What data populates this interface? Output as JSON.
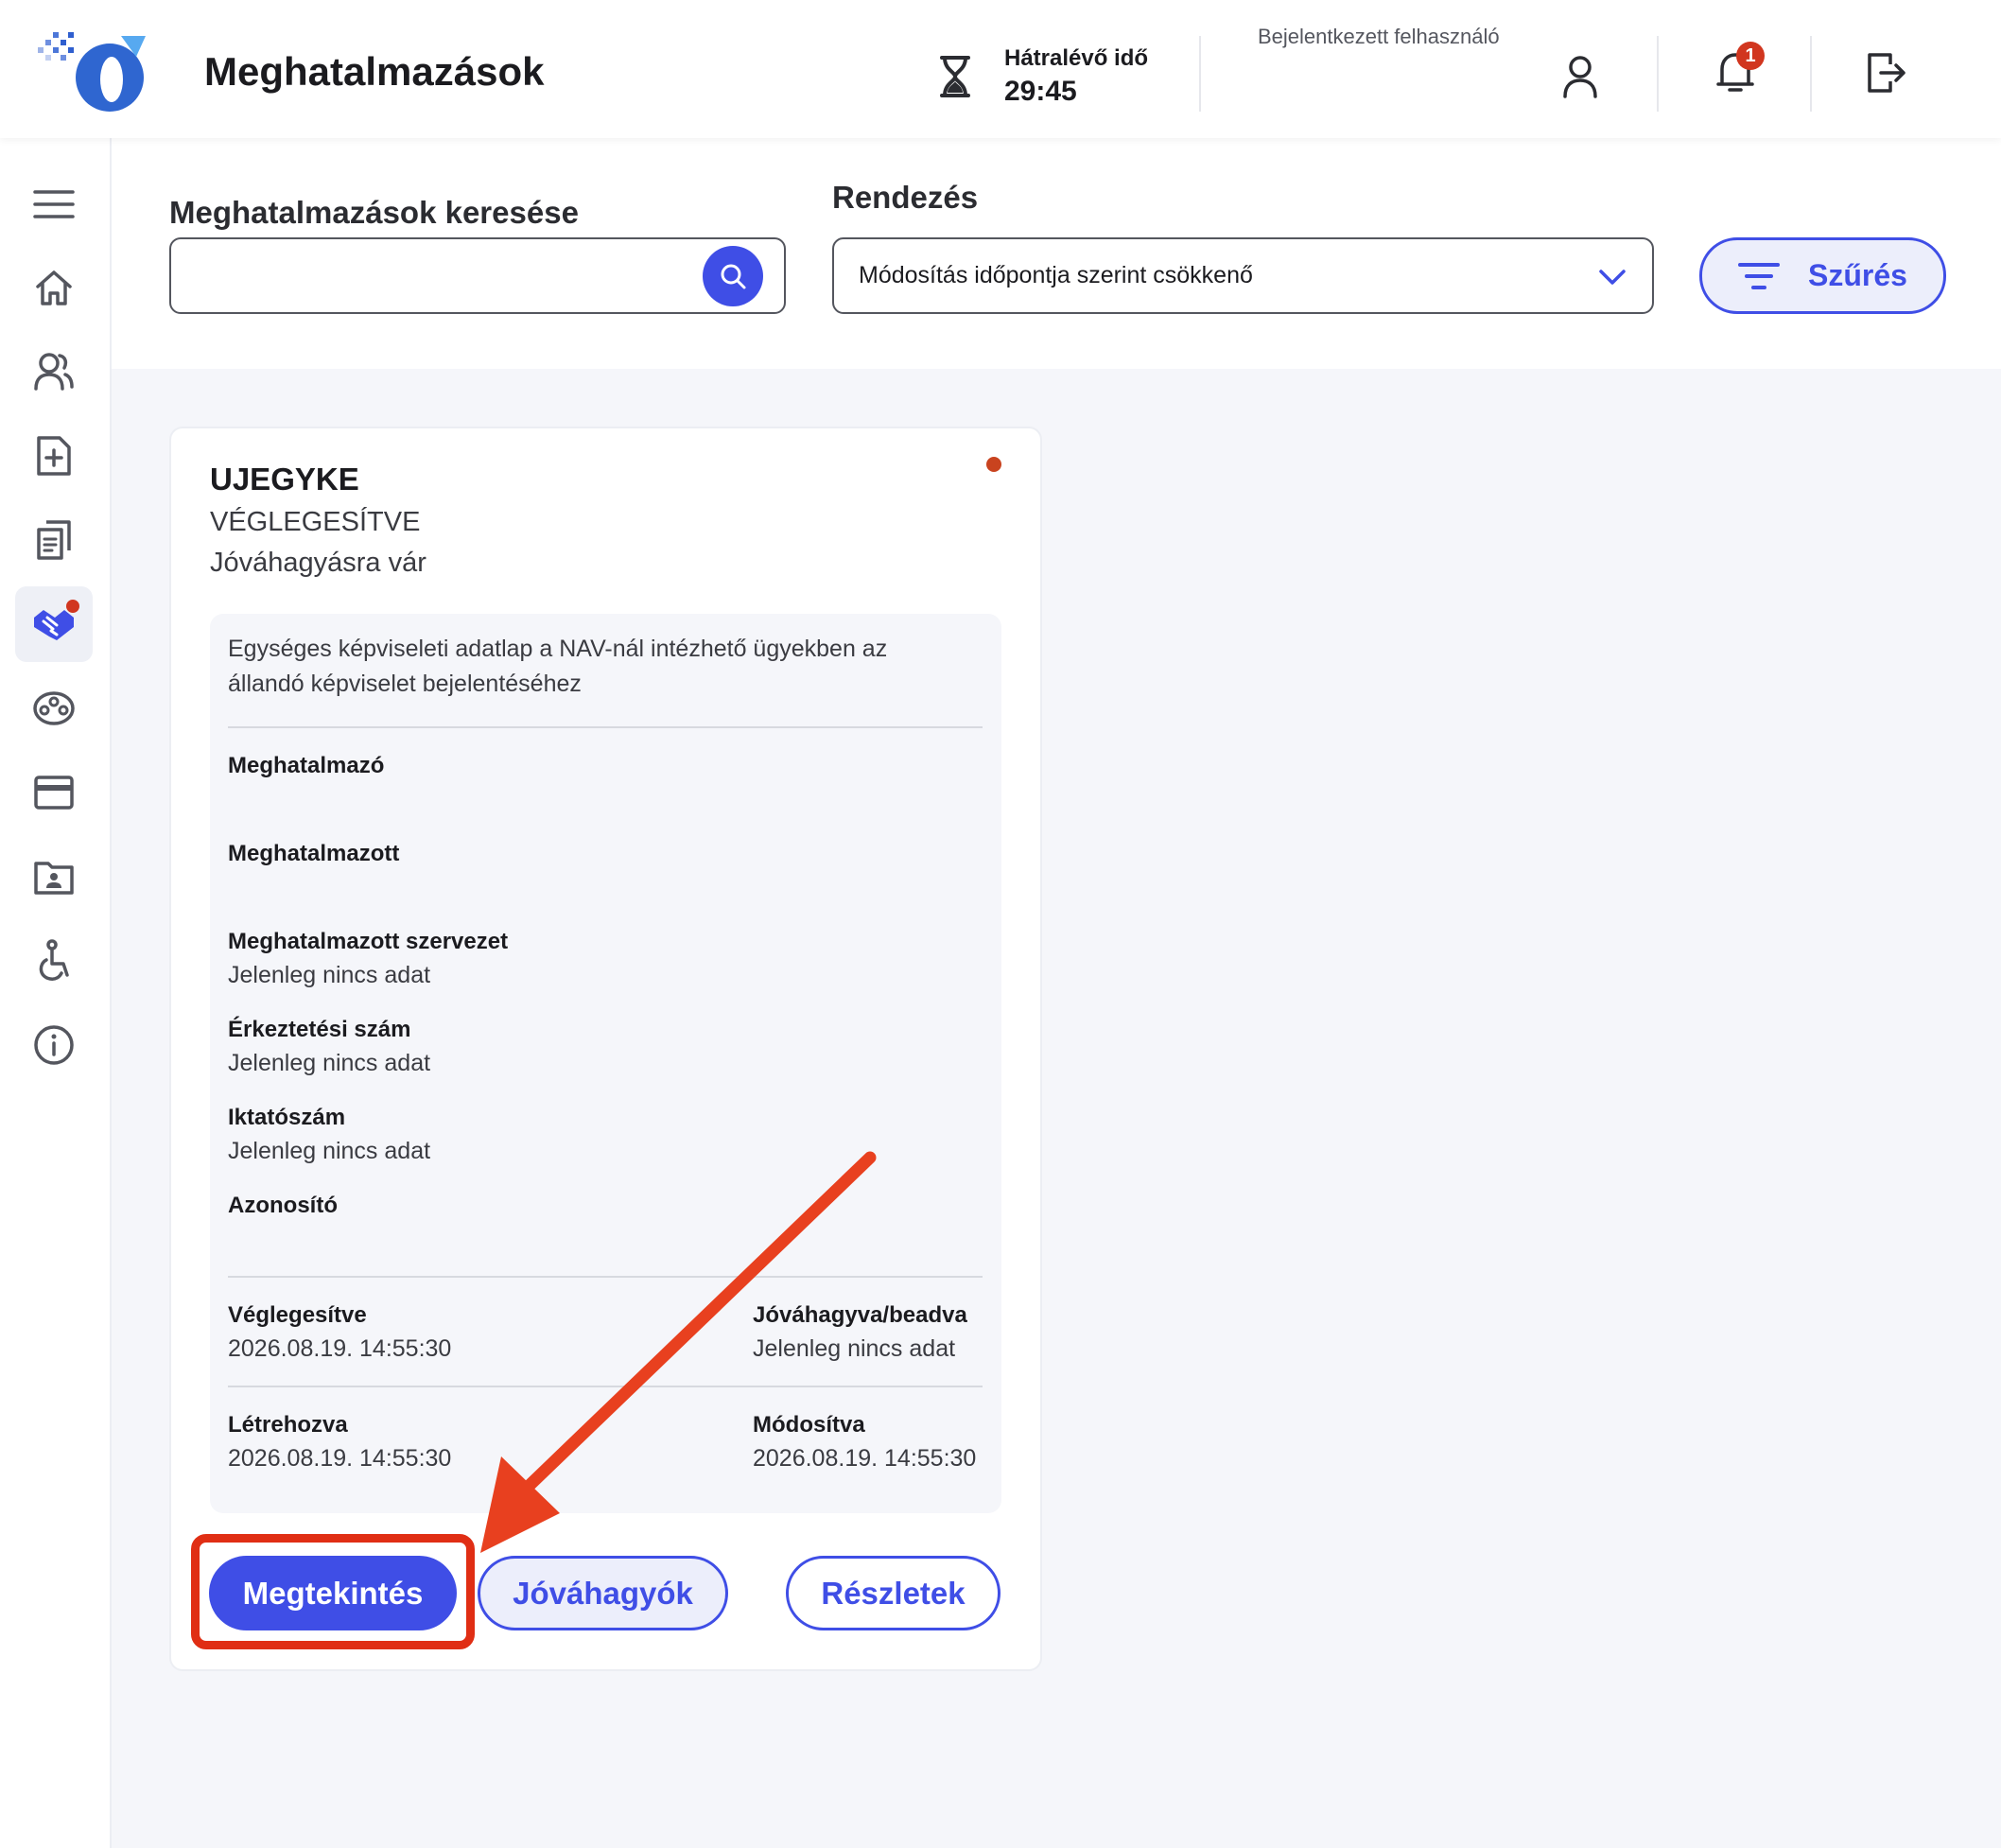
{
  "header": {
    "title": "Meghatalmazások",
    "timer_label": "Hátralévő idő",
    "timer_value": "29:45",
    "user_label": "Bejelentkezett felhasználó",
    "notification_count": "1"
  },
  "sidebar": {
    "items": [
      {
        "name": "menu",
        "icon": "hamburger-icon"
      },
      {
        "name": "home",
        "icon": "home-icon"
      },
      {
        "name": "users",
        "icon": "users-icon"
      },
      {
        "name": "new-document",
        "icon": "document-plus-icon"
      },
      {
        "name": "documents",
        "icon": "documents-icon"
      },
      {
        "name": "authorizations",
        "icon": "handshake-icon",
        "active": true
      },
      {
        "name": "community",
        "icon": "community-icon"
      },
      {
        "name": "payments",
        "icon": "card-icon"
      },
      {
        "name": "profile",
        "icon": "id-card-icon"
      },
      {
        "name": "accessibility",
        "icon": "accessibility-icon"
      },
      {
        "name": "info",
        "icon": "info-icon"
      }
    ]
  },
  "search": {
    "label": "Meghatalmazások keresése",
    "value": "",
    "placeholder": ""
  },
  "sort": {
    "label": "Rendezés",
    "selected": "Módosítás időpontja szerint csökkenő"
  },
  "filter": {
    "label": "Szűrés"
  },
  "card": {
    "title": "UJEGYKE",
    "status": "VÉGLEGESÍTVE",
    "substatus": "Jóváhagyásra vár",
    "description": "Egységes képviseleti adatlap a NAV-nál intézhető ügyekben az állandó képviselet bejelentéséhez",
    "fields": {
      "principal_label": "Meghatalmazó",
      "agent_label": "Meghatalmazott",
      "org_label": "Meghatalmazott szervezet",
      "org_value": "Jelenleg nincs adat",
      "arrival_label": "Érkeztetési szám",
      "arrival_value": "Jelenleg nincs adat",
      "filing_label": "Iktatószám",
      "filing_value": "Jelenleg nincs adat",
      "id_label": "Azonosító"
    },
    "dates": {
      "finalized_label": "Véglegesítve",
      "finalized_value": "2026.08.19. 14:55:30",
      "approved_label": "Jóváhagyva/beadva",
      "approved_value": "Jelenleg nincs adat",
      "created_label": "Létrehozva",
      "created_value": "2026.08.19. 14:55:30",
      "modified_label": "Módosítva",
      "modified_value": "2026.08.19. 14:55:30"
    },
    "buttons": {
      "view": "Megtekintés",
      "approvers": "Jóváhagyók",
      "details": "Részletek"
    }
  },
  "colors": {
    "accent": "#3f4ee6",
    "highlight": "#e02e14",
    "badge": "#d1361f"
  }
}
